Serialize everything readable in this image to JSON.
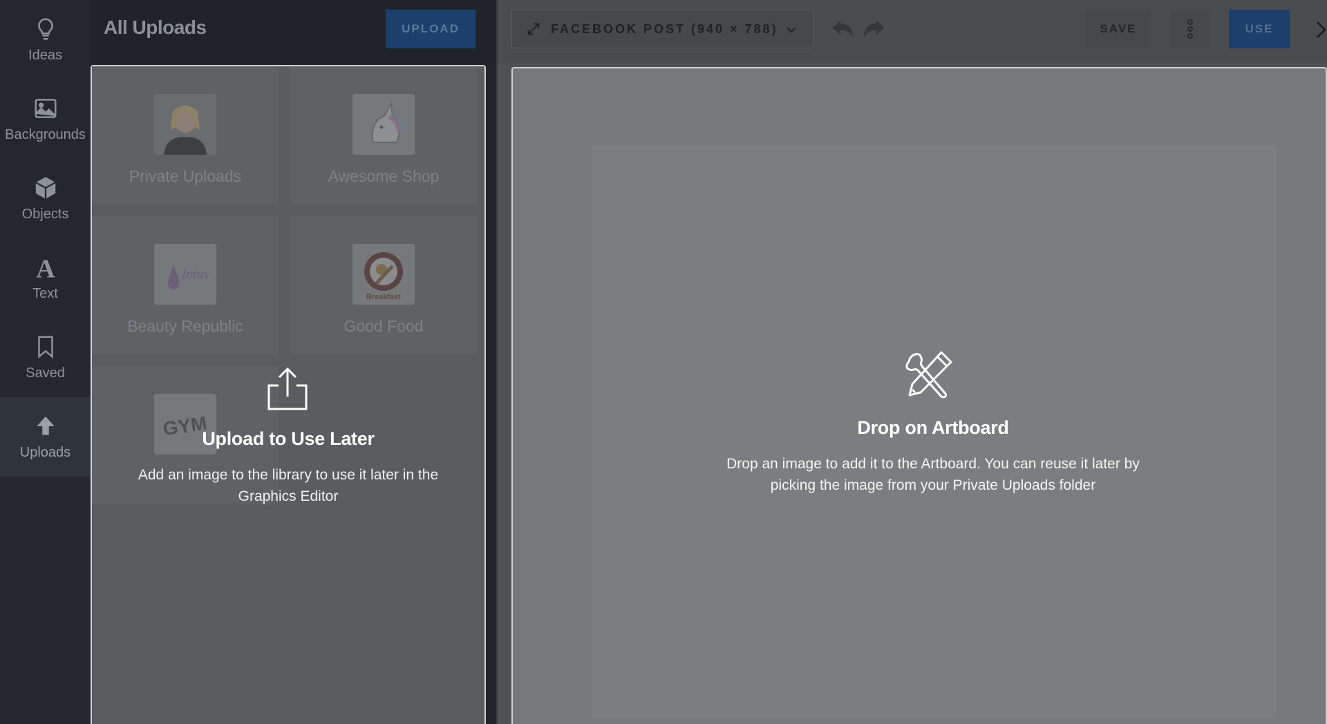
{
  "rail": {
    "items": [
      {
        "label": "Ideas",
        "icon": "lightbulb-icon"
      },
      {
        "label": "Backgrounds",
        "icon": "image-icon"
      },
      {
        "label": "Objects",
        "icon": "cube-icon"
      },
      {
        "label": "Text",
        "icon": "text-icon"
      },
      {
        "label": "Saved",
        "icon": "bookmark-icon"
      },
      {
        "label": "Uploads",
        "icon": "upload-arrow-icon",
        "active": true
      }
    ]
  },
  "panel": {
    "title": "All Uploads",
    "upload_button": "UPLOAD",
    "folders": [
      {
        "name": "Private Uploads",
        "thumb": "portrait-photo"
      },
      {
        "name": "Awesome Shop",
        "thumb": "unicorn-logo"
      },
      {
        "name": "Beauty Republic",
        "thumb": "lotus-logo"
      },
      {
        "name": "Good Food",
        "thumb": "breakfast-logo"
      },
      {
        "name": "",
        "thumb": "gym-logo"
      }
    ],
    "drop_overlay": {
      "title": "Upload to Use Later",
      "description": "Add an image to the library to use it later in the Graphics Editor"
    }
  },
  "toolbar": {
    "format_label": "FACEBOOK POST (940 × 788)",
    "save_label": "SAVE",
    "use_label": "USE"
  },
  "artboard": {
    "title": "Drop on Artboard",
    "description": "Drop an image to add it to the Artboard. You can reuse it later by picking the image from your Private Uploads folder"
  },
  "colors": {
    "accent": "#1c3f6b",
    "rail_bg": "#24272d",
    "overlay_border": "#cfd1d4"
  }
}
